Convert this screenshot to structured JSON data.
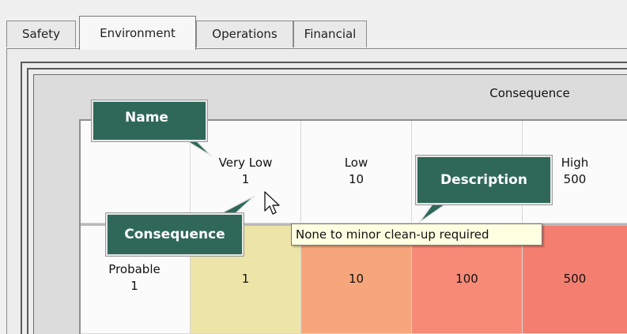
{
  "tabs": [
    {
      "label": "Safety"
    },
    {
      "label": "Environment"
    },
    {
      "label": "Operations"
    },
    {
      "label": "Financial"
    }
  ],
  "active_tab": "Environment",
  "matrix": {
    "consequence_header": "Consequence",
    "columns": [
      {
        "name": "Very Low",
        "value": "1"
      },
      {
        "name": "Low",
        "value": "10"
      },
      {
        "name": "",
        "value": ""
      },
      {
        "name": "High",
        "value": "500"
      }
    ],
    "rows": [
      {
        "name": "Probable",
        "value": "1",
        "cells": [
          "1",
          "10",
          "100",
          "500"
        ]
      }
    ]
  },
  "colors": {
    "cell_1": "#ede5a8",
    "cell_10": "#f7a57b",
    "cell_100": "#f68a77",
    "cell_500": "#f47f70",
    "callout_bg": "#2f6858",
    "tooltip_bg": "#ffffe1"
  },
  "callouts": {
    "name": "Name",
    "description": "Description",
    "consequence": "Consequence"
  },
  "tooltip": {
    "text": "None to minor clean-up required"
  },
  "cursor_icon": "arrow-pointer"
}
